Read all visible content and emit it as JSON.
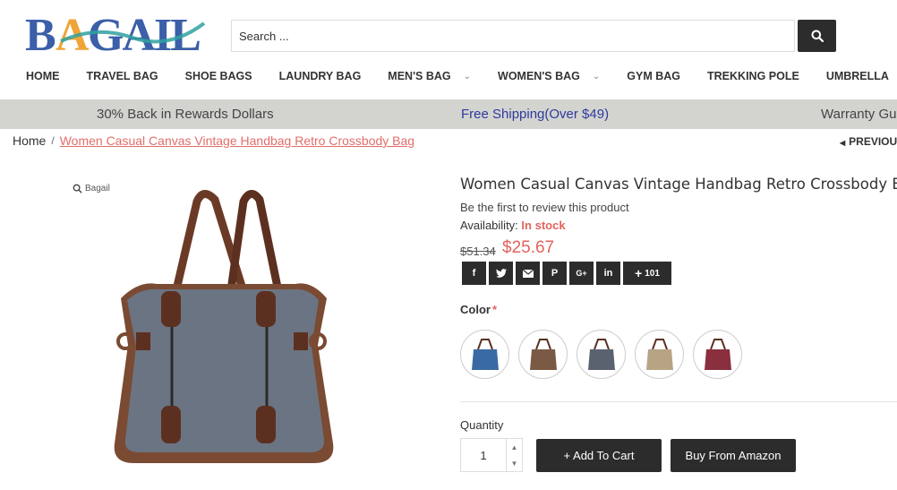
{
  "header": {
    "logo_text": "BAGAIL",
    "search_placeholder": "Search ...",
    "colors": {
      "brand_blue": "#3b5fa8",
      "brand_orange": "#f0a437",
      "brand_teal": "#2fa1a0",
      "accent_red": "#e2635e",
      "dark": "#2c2c2c"
    }
  },
  "nav": {
    "items": [
      {
        "label": "HOME",
        "dropdown": false
      },
      {
        "label": "TRAVEL BAG",
        "dropdown": false
      },
      {
        "label": "SHOE BAGS",
        "dropdown": false
      },
      {
        "label": "LAUNDRY BAG",
        "dropdown": false
      },
      {
        "label": "MEN'S BAG",
        "dropdown": true
      },
      {
        "label": "WOMEN'S BAG",
        "dropdown": true
      },
      {
        "label": "GYM BAG",
        "dropdown": false
      },
      {
        "label": "TREKKING POLE",
        "dropdown": false
      },
      {
        "label": "UMBRELLA",
        "dropdown": false
      }
    ]
  },
  "promo": {
    "rewards": "30% Back in Rewards Dollars",
    "shipping": "Free Shipping(Over $49)",
    "warranty": "Warranty Gu"
  },
  "breadcrumb": {
    "home": "Home",
    "separator": "/",
    "current": "Women Casual Canvas Vintage Handbag Retro Crossbody Bag",
    "previous": "PREVIOUS"
  },
  "product": {
    "zoom_label": "Bagail",
    "title": "Women Casual Canvas Vintage Handbag Retro Crossbody Bag",
    "review_text": "Be the first to review this product",
    "availability_label": "Availability:",
    "availability_value": "In stock",
    "price_old": "$51.34",
    "price_new": "$25.67",
    "share": {
      "icons": [
        "facebook-icon",
        "twitter-icon",
        "email-icon",
        "pinterest-icon",
        "google-plus-icon",
        "linkedin-icon"
      ],
      "more_label": "+",
      "count": "101"
    },
    "color_label": "Color",
    "color_required": "*",
    "swatches": [
      {
        "name": "blue",
        "color": "#3a6aa3"
      },
      {
        "name": "coffee",
        "color": "#7a5a44"
      },
      {
        "name": "gray",
        "color": "#5a6270"
      },
      {
        "name": "khaki",
        "color": "#b7a485"
      },
      {
        "name": "burgundy",
        "color": "#8a2f3e"
      }
    ],
    "quantity_label": "Quantity",
    "quantity_value": "1",
    "add_to_cart": "+ Add To Cart",
    "buy_amazon": "Buy From Amazon"
  }
}
